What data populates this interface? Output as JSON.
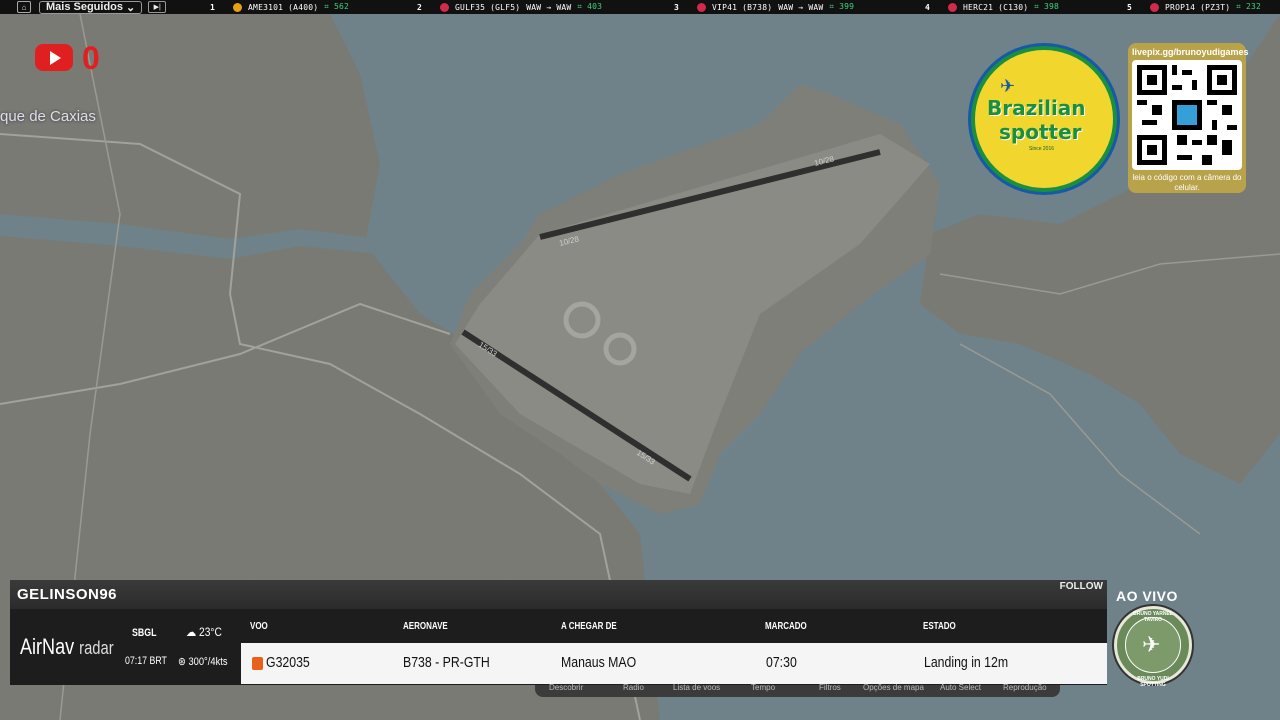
{
  "ticker": {
    "home_icon": "home-icon",
    "dropdown_label": "Mais Seguidos",
    "play_icon": "skip-icon",
    "items": [
      {
        "rank": "1",
        "callsign": "AME3101 (A400)",
        "route": "",
        "count": "562",
        "flag_color": "#e9a010"
      },
      {
        "rank": "2",
        "callsign": "GULF35 (GLF5)",
        "route": "WAW → WAW",
        "count": "403",
        "flag_color": "#d22a4a"
      },
      {
        "rank": "3",
        "callsign": "VIP41 (B738)",
        "route": "WAW → WAW",
        "count": "399",
        "flag_color": "#d22a4a"
      },
      {
        "rank": "4",
        "callsign": "HERC21 (C130)",
        "route": "",
        "count": "398",
        "flag_color": "#d22a4a"
      },
      {
        "rank": "5",
        "callsign": "PROP14 (PZ3T)",
        "route": "",
        "count": "232",
        "flag_color": "#d22a4a"
      }
    ]
  },
  "map": {
    "place_label": "que de Caxias",
    "runway_labels": [
      "10/28",
      "10/28",
      "15/33",
      "15/33"
    ]
  },
  "youtube": {
    "count": "0"
  },
  "logo": {
    "line1": "Brazilian",
    "line2": "spotter",
    "since": "Since 2016"
  },
  "qr": {
    "url": "livepix.gg/brunoyudigames",
    "caption": "leia o código com a câmera do celular."
  },
  "panel": {
    "username": "GELINSON96",
    "follow": "FOLLOW",
    "brand_main": "AirNav",
    "brand_sub": "radar",
    "icao": "SBGL",
    "local_time": "07:17 BRT",
    "temperature": "23°C",
    "wind": "300°/4kts",
    "headers": {
      "flight": "VOO",
      "aircraft": "AERONAVE",
      "from": "A CHEGAR DE",
      "scheduled": "MARCADO",
      "status": "ESTADO"
    },
    "row": {
      "flight": "G32035",
      "aircraft": "B738 - PR-GTH",
      "from": "Manaus MAO",
      "scheduled": "07:30",
      "status": "Landing in 12m"
    }
  },
  "controls": [
    "Descobrir",
    "Radio",
    "Lista de voos",
    "Tempo",
    "Filtros",
    "Opções de mapa",
    "Auto Select",
    "Reprodução"
  ],
  "live": {
    "label": "AO VIVO",
    "emblem_top": "BRUNO YARNEL TAVIRO",
    "emblem_bottom": "BRUNO YUDI SPOTTING"
  },
  "colors": {
    "water": "#6f8189",
    "land": "#7a7a74",
    "airport": "#8b8b86",
    "accent_red": "#e02020",
    "brand_green": "#1a8f3f"
  }
}
